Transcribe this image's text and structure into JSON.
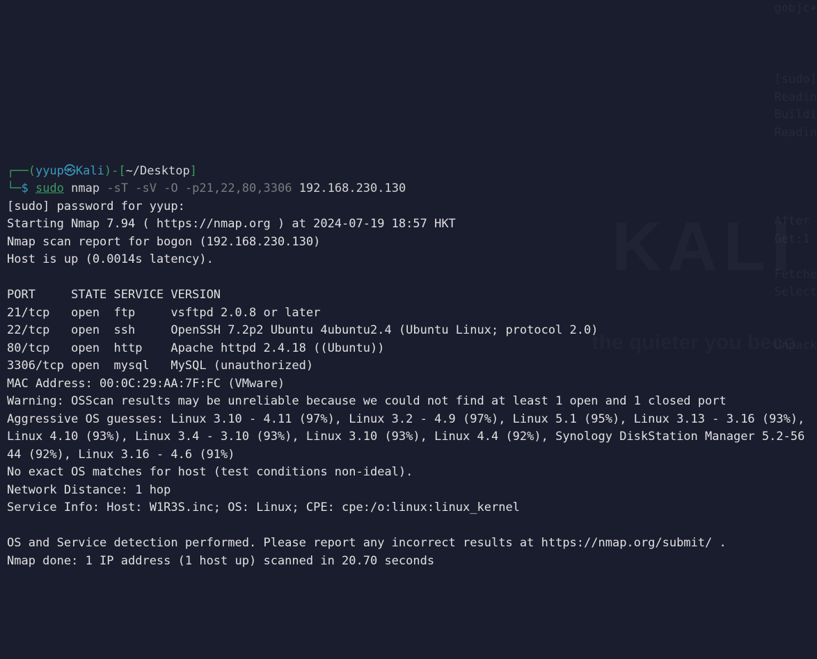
{
  "prompt": {
    "deco_open": "┌──(",
    "user": "yyup",
    "at": "㉿",
    "host": "Kali",
    "deco_close": ")-[",
    "path": "~/Desktop",
    "deco_close2": "]",
    "line2_deco": "└─",
    "dollar": "$ ",
    "sudo": "sudo",
    "cmd": " nmap ",
    "flags": "-sT -sV -O -p21,22,80,3306",
    "target": " 192.168.230.130"
  },
  "output": {
    "sudo_prompt": "[sudo] password for yyup:",
    "start": "Starting Nmap 7.94 ( https://nmap.org ) at 2024-07-19 18:57 HKT",
    "scan_report": "Nmap scan report for bogon (192.168.230.130)",
    "host_up": "Host is up (0.0014s latency).",
    "blank1": "",
    "header": "PORT     STATE SERVICE VERSION",
    "p21": "21/tcp   open  ftp     vsftpd 2.0.8 or later",
    "p22": "22/tcp   open  ssh     OpenSSH 7.2p2 Ubuntu 4ubuntu2.4 (Ubuntu Linux; protocol 2.0)",
    "p80": "80/tcp   open  http    Apache httpd 2.4.18 ((Ubuntu))",
    "p3306": "3306/tcp open  mysql   MySQL (unauthorized)",
    "mac": "MAC Address: 00:0C:29:AA:7F:FC (VMware)",
    "warn": "Warning: OSScan results may be unreliable because we could not find at least 1 open and 1 closed port",
    "osguess": "Aggressive OS guesses: Linux 3.10 - 4.11 (97%), Linux 3.2 - 4.9 (97%), Linux 5.1 (95%), Linux 3.13 - 3.16 (93%), Linux 4.10 (93%), Linux 3.4 - 3.10 (93%), Linux 3.10 (93%), Linux 4.4 (92%), Synology DiskStation Manager 5.2-5644 (92%), Linux 3.16 - 4.6 (91%)",
    "nomatch": "No exact OS matches for host (test conditions non-ideal).",
    "netdist": "Network Distance: 1 hop",
    "svcinfo": "Service Info: Host: W1R3S.inc; OS: Linux; CPE: cpe:/o:linux:linux_kernel",
    "blank2": "",
    "footer1": "OS and Service detection performed. Please report any incorrect results at https://nmap.org/submit/ .",
    "done": "Nmap done: 1 IP address (1 host up) scanned in 20.70 seconds"
  },
  "watermark": {
    "big": "KALI",
    "sub": "the quieter you beco"
  },
  "ghost": {
    "l1": "gobjc+",
    "l6": "[sudo]",
    "l7": "Readin",
    "l8": "Buildi",
    "l9": "Readin",
    "l14": "After",
    "l15": "Get:1",
    "l17": "Fetche",
    "l18": "Select",
    "l21": "Unpack"
  }
}
